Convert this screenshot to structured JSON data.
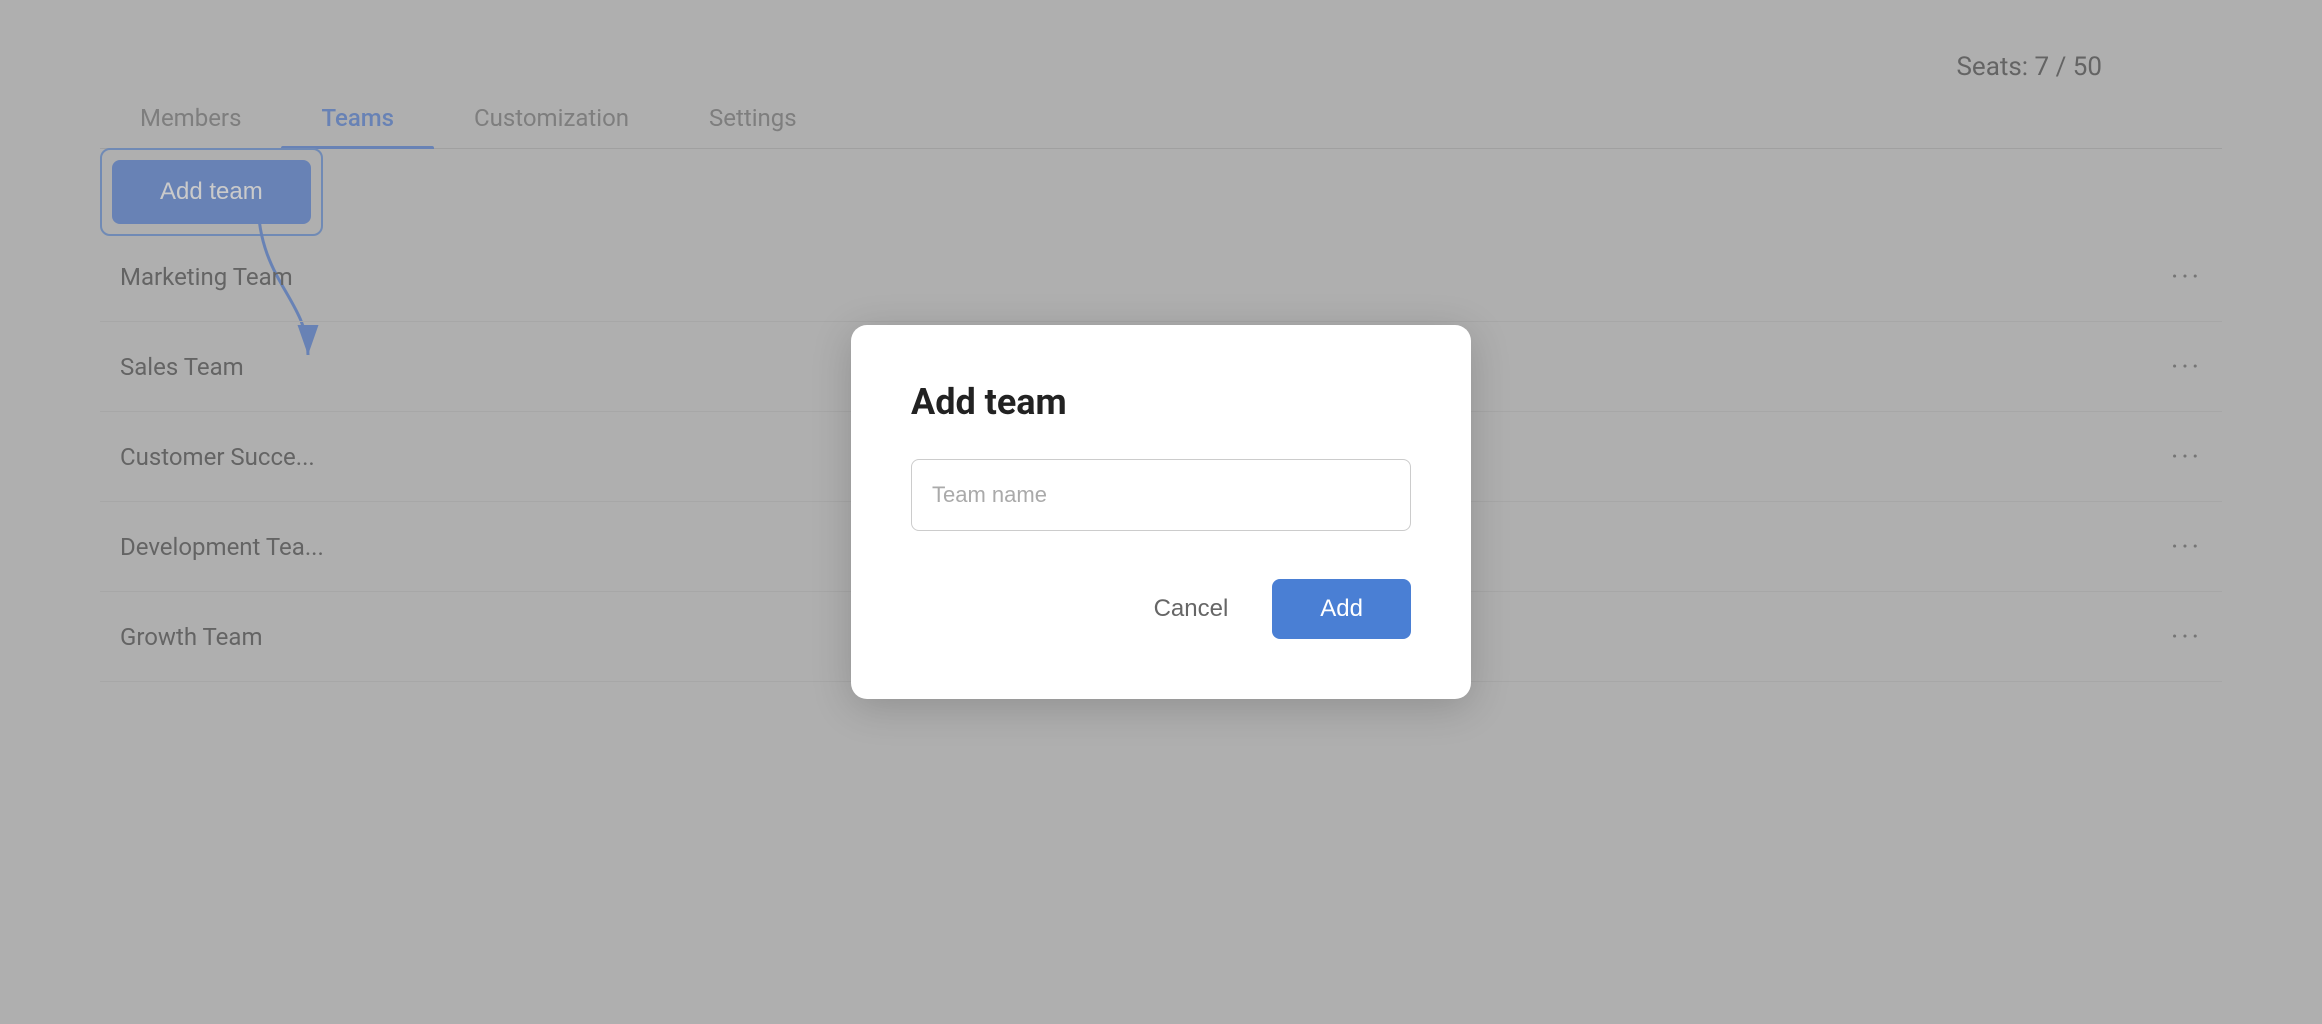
{
  "seats": {
    "label": "Seats: 7 / 50"
  },
  "tabs": [
    {
      "id": "members",
      "label": "Members",
      "active": false
    },
    {
      "id": "teams",
      "label": "Teams",
      "active": true
    },
    {
      "id": "customization",
      "label": "Customization",
      "active": false
    },
    {
      "id": "settings",
      "label": "Settings",
      "active": false
    }
  ],
  "add_team_button": {
    "label": "Add team"
  },
  "teams": [
    {
      "id": 1,
      "name": "Marketing Team"
    },
    {
      "id": 2,
      "name": "Sales Team"
    },
    {
      "id": 3,
      "name": "Customer Succe..."
    },
    {
      "id": 4,
      "name": "Development Tea..."
    },
    {
      "id": 5,
      "name": "Growth Team"
    }
  ],
  "modal": {
    "title": "Add team",
    "input_placeholder": "Team name",
    "cancel_label": "Cancel",
    "add_label": "Add"
  },
  "colors": {
    "accent": "#4a7fd4",
    "button_bg": "#3b6fd4"
  }
}
